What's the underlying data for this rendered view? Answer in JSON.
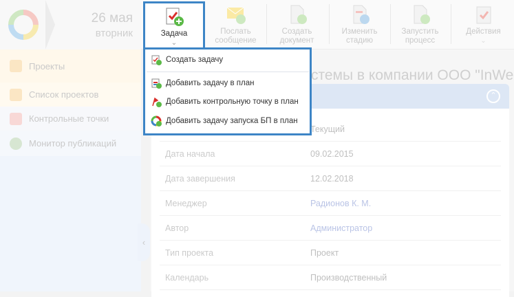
{
  "header": {
    "date": "26 мая",
    "weekday": "вторник"
  },
  "toolbar": [
    {
      "label": "Задача",
      "icon": "task-add-icon"
    },
    {
      "label": "Послать сообщение",
      "icon": "envelope-icon"
    },
    {
      "label": "Создать документ",
      "icon": "document-add-icon"
    },
    {
      "label": "Изменить стадию",
      "icon": "change-stage-icon"
    },
    {
      "label": "Запустить процесс",
      "icon": "run-process-icon"
    },
    {
      "label": "Действия",
      "icon": "actions-icon"
    }
  ],
  "dropdown": {
    "items": [
      {
        "label": "Создать задачу"
      },
      {
        "label": "Добавить задачу в план"
      },
      {
        "label": "Добавить контрольную точку в план"
      },
      {
        "label": "Добавить задачу запуска БП в план"
      }
    ]
  },
  "sidebar": {
    "items": [
      {
        "label": "Проекты"
      },
      {
        "label": "Список проектов"
      },
      {
        "label": "Контрольные точки"
      },
      {
        "label": "Монитор публикаций"
      }
    ]
  },
  "main": {
    "title": "стемы в компании ООО \"InWes",
    "rows": [
      {
        "label": "",
        "value": "Текущий"
      },
      {
        "label": "Дата начала",
        "value": "09.02.2015"
      },
      {
        "label": "Дата завершения",
        "value": "12.02.2018"
      },
      {
        "label": "Менеджер",
        "value": "Радионов К. М."
      },
      {
        "label": "Автор",
        "value": "Администратор"
      },
      {
        "label": "Тип проекта",
        "value": "Проект"
      },
      {
        "label": "Календарь",
        "value": "Производственный"
      }
    ]
  },
  "colors": {
    "accent": "#3d85c6",
    "panel_header": "#dde7f5"
  }
}
